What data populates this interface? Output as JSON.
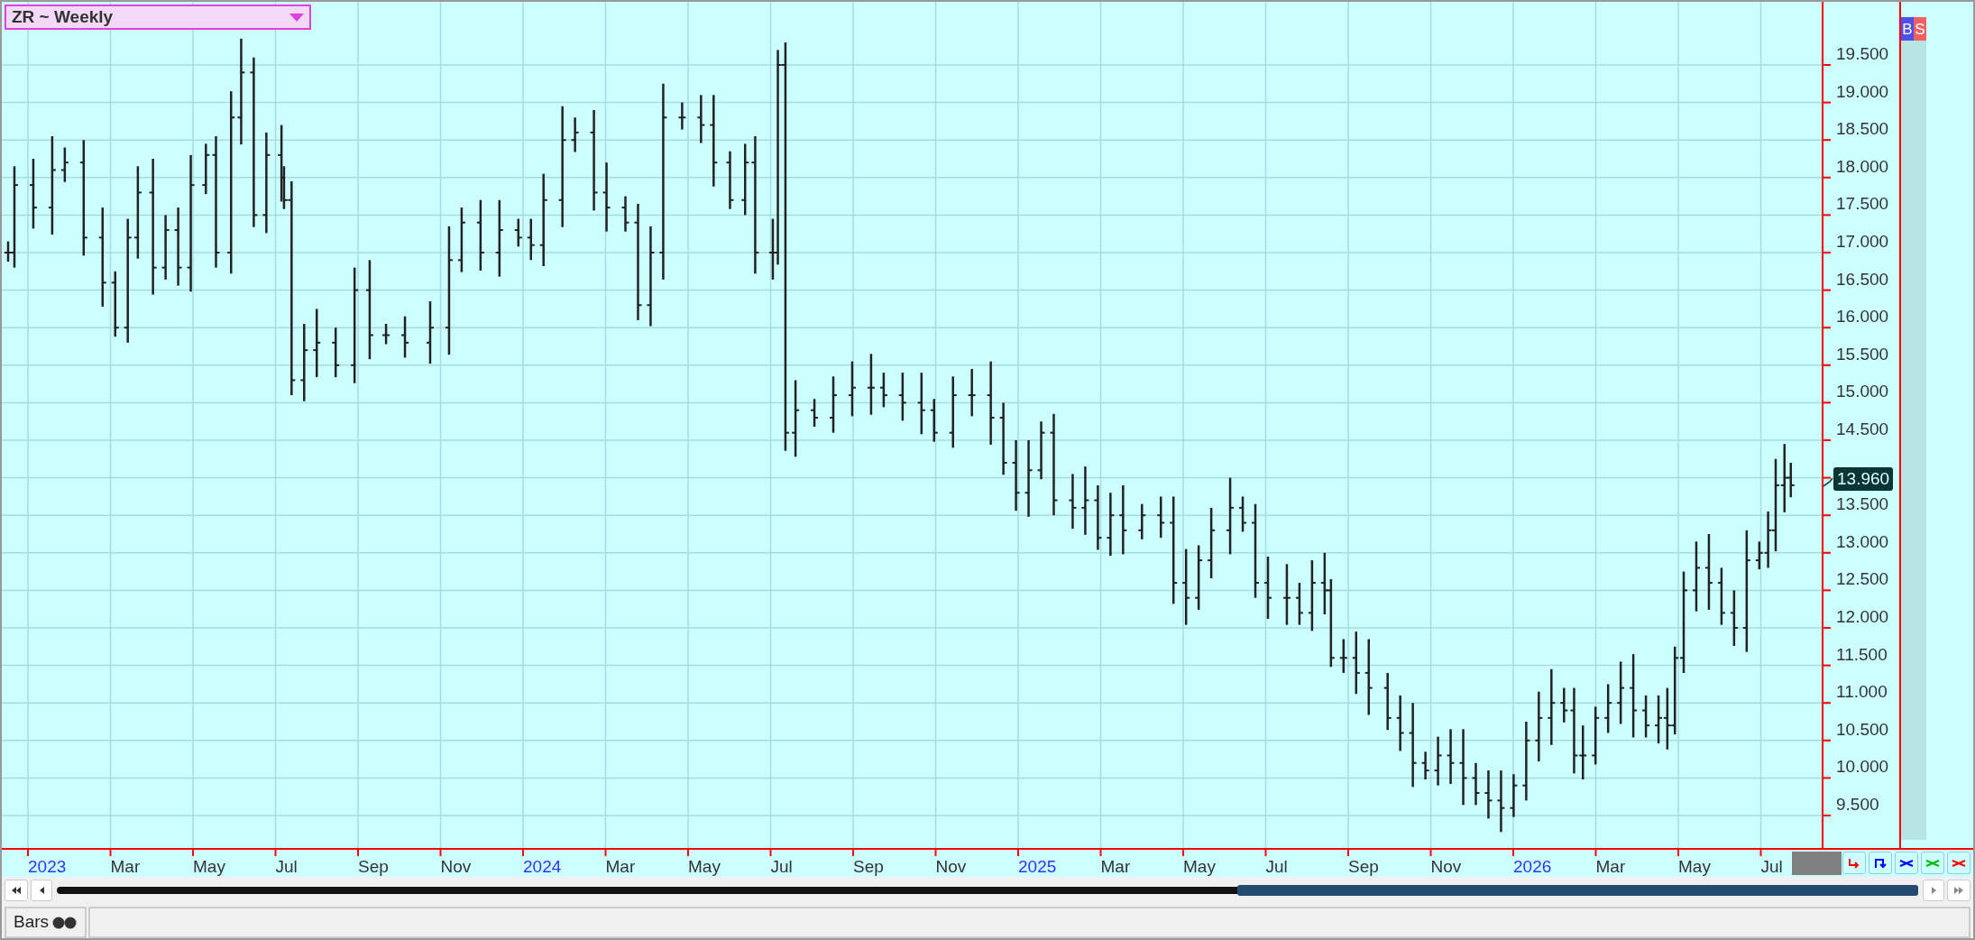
{
  "chart": {
    "title": "ZR ~ Weekly",
    "last_price": "13.960",
    "y_ticks": [
      "19.500",
      "19.000",
      "18.500",
      "18.000",
      "17.500",
      "17.000",
      "16.500",
      "16.000",
      "15.500",
      "15.000",
      "14.500",
      "13.500",
      "13.000",
      "12.500",
      "12.000",
      "11.500",
      "11.000",
      "10.500",
      "10.000",
      "9.500"
    ],
    "x_ticks": [
      {
        "label": "2023",
        "kind": "year"
      },
      {
        "label": "Mar",
        "kind": "month"
      },
      {
        "label": "May",
        "kind": "month"
      },
      {
        "label": "Jul",
        "kind": "month"
      },
      {
        "label": "Sep",
        "kind": "month"
      },
      {
        "label": "Nov",
        "kind": "month"
      },
      {
        "label": "2024",
        "kind": "year"
      },
      {
        "label": "Mar",
        "kind": "month"
      },
      {
        "label": "May",
        "kind": "month"
      },
      {
        "label": "Jul",
        "kind": "month"
      },
      {
        "label": "Sep",
        "kind": "month"
      },
      {
        "label": "Nov",
        "kind": "month"
      },
      {
        "label": "2025",
        "kind": "year"
      },
      {
        "label": "Mar",
        "kind": "month"
      },
      {
        "label": "May",
        "kind": "month"
      },
      {
        "label": "Jul",
        "kind": "month"
      },
      {
        "label": "Sep",
        "kind": "month"
      },
      {
        "label": "Nov",
        "kind": "month"
      },
      {
        "label": "2026",
        "kind": "year"
      },
      {
        "label": "Mar",
        "kind": "month"
      },
      {
        "label": "May",
        "kind": "month"
      },
      {
        "label": "Jul",
        "kind": "month"
      }
    ]
  },
  "side_buttons": [
    {
      "label": "B",
      "kind": "buy"
    },
    {
      "label": "S",
      "kind": "sell"
    }
  ],
  "status_bar": {
    "tab": "Bars"
  }
}
